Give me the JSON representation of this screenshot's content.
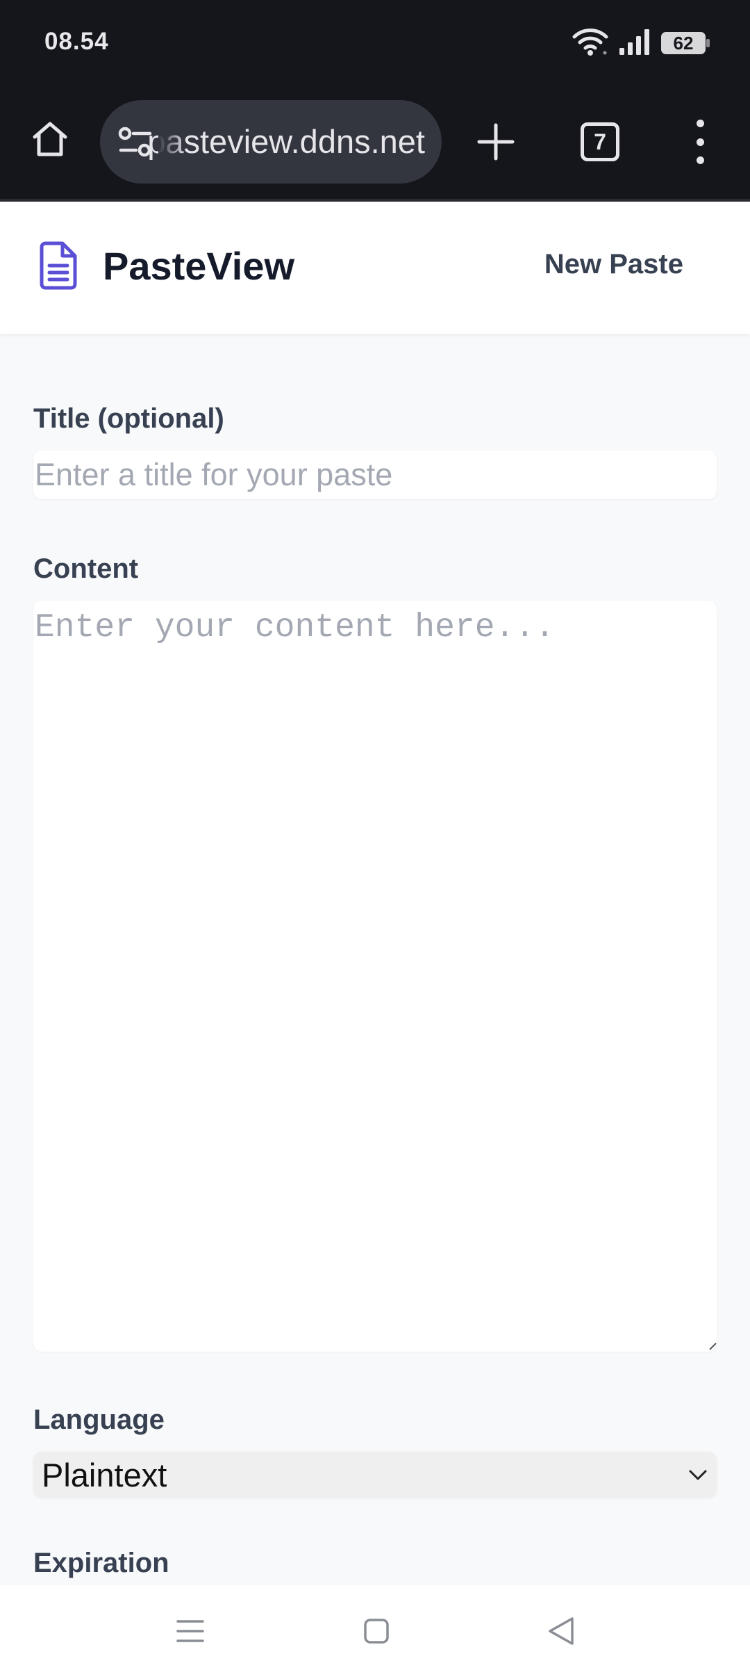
{
  "status_bar": {
    "time": "08.54",
    "battery": "62",
    "icons": [
      "wifi-icon",
      "signal-icon",
      "battery-icon"
    ]
  },
  "browser": {
    "url": "pasteview.ddns.net",
    "tab_count": "7",
    "icons": [
      "home-icon",
      "site-settings-icon",
      "new-tab-plus-icon",
      "tabs-icon",
      "more-vert-icon"
    ]
  },
  "header": {
    "app_name": "PasteView",
    "new_paste_label": "New Paste",
    "brand_color": "#5b4fd6"
  },
  "form": {
    "title_label": "Title (optional)",
    "title_placeholder": "Enter a title for your paste",
    "content_label": "Content",
    "content_placeholder": "Enter your content here...",
    "language_label": "Language",
    "language_value": "Plaintext",
    "expiration_label": "Expiration"
  },
  "navbar": {
    "icons": [
      "recents-icon",
      "home-square-icon",
      "back-triangle-icon"
    ]
  }
}
